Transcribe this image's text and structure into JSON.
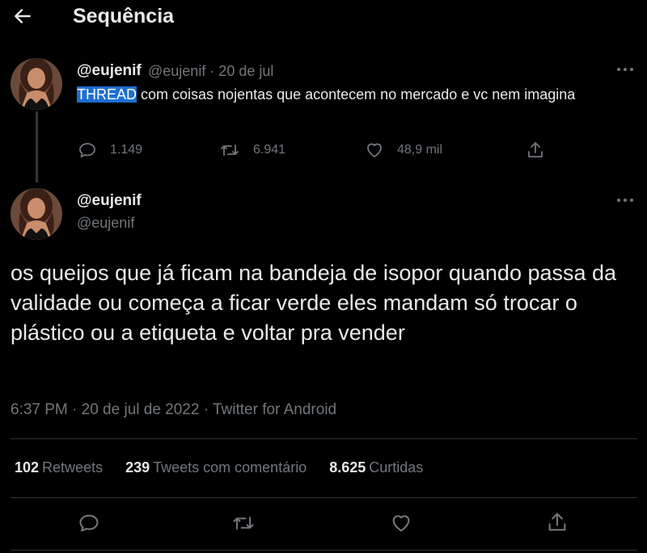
{
  "header": {
    "title": "Sequência",
    "back_icon": "arrow-left-icon"
  },
  "tweet1": {
    "display_name": "@eujenif",
    "meta": "@eujenif · 20 de jul",
    "text_highlight": "THREAD",
    "text_rest": " com coisas nojentas que acontecem no mercado e vc nem imagina",
    "replies": "1.149",
    "retweets": "6.941",
    "likes": "48,9 mil"
  },
  "tweet2": {
    "display_name": "@eujenif",
    "handle": "@eujenif",
    "text": "os queijos que já ficam na bandeja de isopor quando passa da validade ou começa a ficar verde eles mandam só trocar o plástico ou a etiqueta e voltar pra vender",
    "meta": "6:37 PM · 20 de jul de 2022 · Twitter for Android",
    "stats": {
      "retweets_value": "102",
      "retweets_label": "Retweets",
      "quotes_value": "239",
      "quotes_label": "Tweets com comentário",
      "likes_value": "8.625",
      "likes_label": "Curtidas"
    }
  },
  "colors": {
    "background": "#000000",
    "text_primary": "#e7e9ea",
    "text_muted": "#71767b",
    "highlight": "#1d6fd0",
    "divider": "#2f3336"
  }
}
